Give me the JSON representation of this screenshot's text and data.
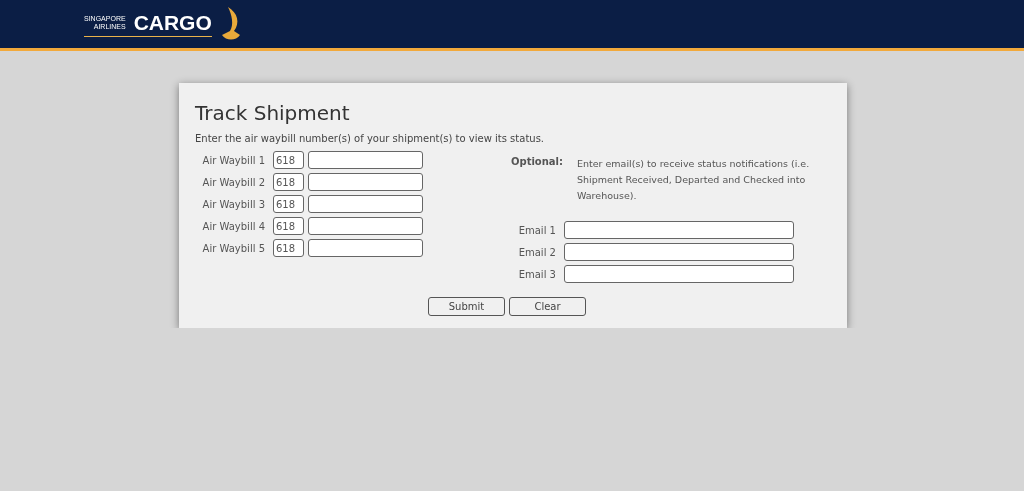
{
  "header": {
    "logo": {
      "line_1": "SINGAPORE",
      "line_2": "AIRLINES",
      "wordmark": "CARGO"
    }
  },
  "form": {
    "title": "Track Shipment",
    "intro": "Enter the air waybill number(s) of your shipment(s) to view its status.",
    "waybills": [
      {
        "label": "Air Waybill 1",
        "prefix": "618"
      },
      {
        "label": "Air Waybill 2",
        "prefix": "618"
      },
      {
        "label": "Air Waybill 3",
        "prefix": "618"
      },
      {
        "label": "Air Waybill 4",
        "prefix": "618"
      },
      {
        "label": "Air Waybill 5",
        "prefix": "618"
      }
    ],
    "optional_label": "Optional:",
    "optional_note": "Enter email(s) to receive status notifications (i.e. Shipment Received, Departed and Checked into Warehouse).",
    "emails": [
      {
        "label": "Email 1"
      },
      {
        "label": "Email 2"
      },
      {
        "label": "Email 3"
      }
    ],
    "buttons": [
      "Submit",
      "Clear"
    ]
  }
}
